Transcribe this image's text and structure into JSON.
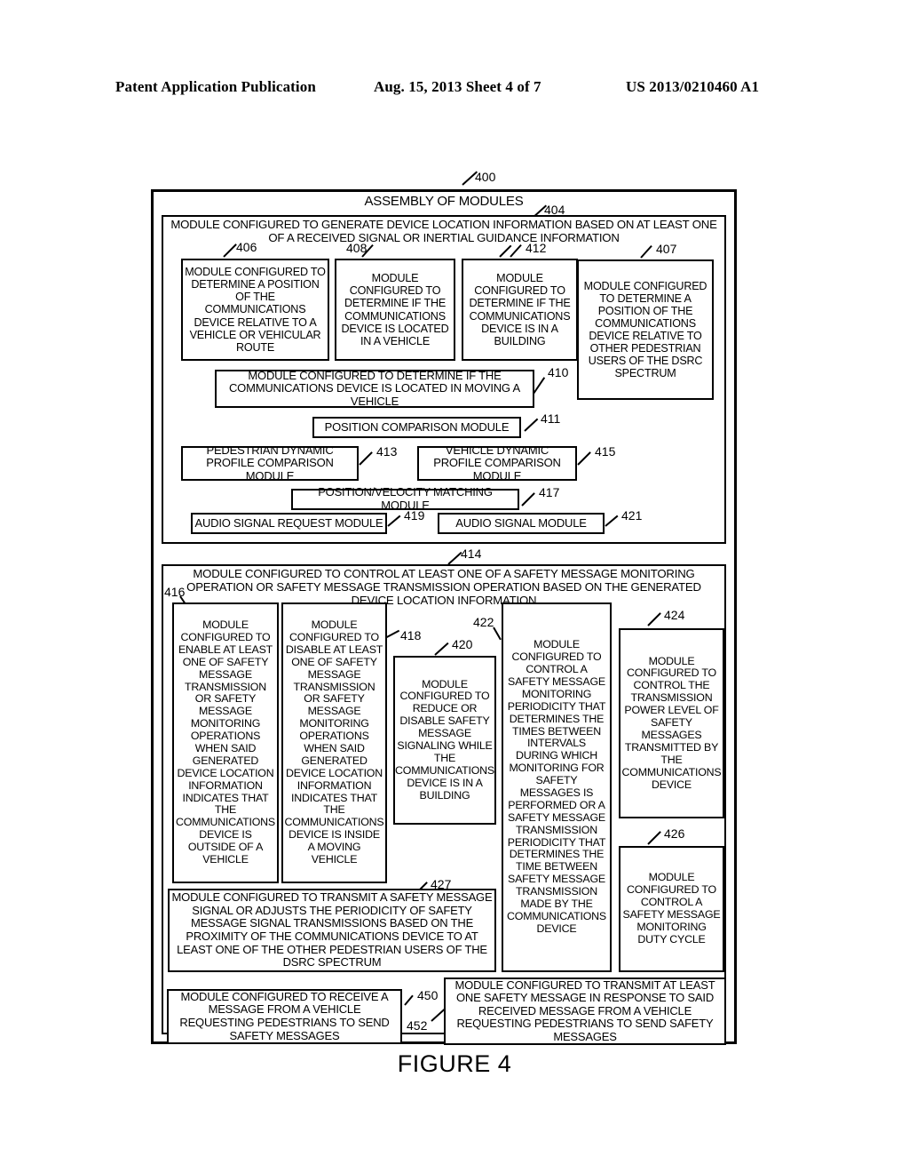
{
  "header": {
    "left": "Patent Application Publication",
    "middle": "Aug. 15, 2013  Sheet 4 of 7",
    "right": "US 2013/0210460 A1"
  },
  "figure": {
    "caption": "FIGURE 4",
    "assembly_label": "ASSEMBLY OF MODULES",
    "refs": {
      "r400": "400",
      "r404": "404",
      "r406": "406",
      "r407": "407",
      "r408": "408",
      "r410": "410",
      "r411": "411",
      "r412": "412",
      "r413": "413",
      "r414": "414",
      "r415": "415",
      "r416": "416",
      "r417": "417",
      "r418": "418",
      "r419": "419",
      "r420": "420",
      "r421": "421",
      "r422": "422",
      "r424": "424",
      "r426": "426",
      "r427": "427",
      "r450": "450",
      "r452": "452"
    },
    "blocks": {
      "b404": "MODULE CONFIGURED TO GENERATE DEVICE LOCATION INFORMATION BASED ON AT LEAST ONE OF A RECEIVED SIGNAL OR INERTIAL GUIDANCE INFORMATION",
      "b406": "MODULE CONFIGURED TO DETERMINE A POSITION OF THE COMMUNICATIONS DEVICE RELATIVE TO A VEHICLE OR VEHICULAR ROUTE",
      "b408": "MODULE CONFIGURED TO DETERMINE IF THE COMMUNICATIONS DEVICE IS LOCATED IN A VEHICLE",
      "b412": "MODULE CONFIGURED TO DETERMINE IF THE COMMUNICATIONS DEVICE IS IN A BUILDING",
      "b407": "MODULE CONFIGURED TO DETERMINE A POSITION OF THE COMMUNICATIONS DEVICE RELATIVE TO OTHER PEDESTRIAN USERS OF THE DSRC SPECTRUM",
      "b410": "MODULE CONFIGURED TO DETERMINE IF THE COMMUNICATIONS DEVICE IS LOCATED IN MOVING A VEHICLE",
      "b411": "POSITION COMPARISON MODULE",
      "b413": "PEDESTRIAN DYNAMIC PROFILE COMPARISON MODULE",
      "b415": "VEHICLE DYNAMIC PROFILE COMPARISON MODULE",
      "b417": "POSITION/VELOCITY MATCHING  MODULE",
      "b419": "AUDIO SIGNAL REQUEST MODULE",
      "b421": "AUDIO SIGNAL MODULE",
      "b414": "MODULE CONFIGURED TO CONTROL AT LEAST ONE OF A SAFETY MESSAGE MONITORING OPERATION OR SAFETY MESSAGE TRANSMISSION OPERATION BASED ON THE GENERATED DEVICE LOCATION INFORMATION",
      "b416": "MODULE CONFIGURED TO ENABLE AT LEAST ONE OF SAFETY MESSAGE TRANSMISSION OR SAFETY MESSAGE MONITORING OPERATIONS WHEN SAID GENERATED DEVICE LOCATION INFORMATION INDICATES THAT THE COMMUNICATIONS DEVICE IS OUTSIDE OF A VEHICLE",
      "b418": "MODULE CONFIGURED TO DISABLE AT LEAST ONE OF SAFETY MESSAGE TRANSMISSION OR SAFETY MESSAGE MONITORING OPERATIONS WHEN SAID GENERATED DEVICE LOCATION INFORMATION INDICATES THAT THE COMMUNICATIONS DEVICE IS INSIDE A MOVING VEHICLE",
      "b420": "MODULE CONFIGURED TO REDUCE OR DISABLE SAFETY MESSAGE SIGNALING WHILE THE COMMUNICATIONS DEVICE IS IN A BUILDING",
      "b422": "MODULE CONFIGURED TO CONTROL A SAFETY MESSAGE MONITORING PERIODICITY THAT DETERMINES THE TIMES BETWEEN INTERVALS DURING WHICH MONITORING FOR SAFETY MESSAGES IS PERFORMED OR A SAFETY MESSAGE TRANSMISSION PERIODICITY THAT DETERMINES THE TIME BETWEEN SAFETY MESSAGE TRANSMISSION MADE BY THE COMMUNICATIONS DEVICE",
      "b424": "MODULE CONFIGURED TO CONTROL THE TRANSMISSION POWER LEVEL OF SAFETY MESSAGES TRANSMITTED BY THE COMMUNICATIONS DEVICE",
      "b426": "MODULE CONFIGURED TO CONTROL A SAFETY MESSAGE MONITORING DUTY CYCLE",
      "b427": "MODULE CONFIGURED TO TRANSMIT A SAFETY MESSAGE SIGNAL OR ADJUSTS THE PERIODICITY OF SAFETY MESSAGE SIGNAL TRANSMISSIONS BASED ON THE PROXIMITY OF THE COMMUNICATIONS DEVICE TO AT LEAST ONE OF THE OTHER PEDESTRIAN USERS OF THE DSRC SPECTRUM",
      "b450": "MODULE CONFIGURED TO RECEIVE A MESSAGE FROM A VEHICLE REQUESTING PEDESTRIANS TO SEND SAFETY MESSAGES",
      "b452": "MODULE CONFIGURED TO TRANSMIT AT LEAST ONE SAFETY MESSAGE IN RESPONSE TO SAID RECEIVED MESSAGE FROM A VEHICLE REQUESTING PEDESTRIANS TO SEND SAFETY MESSAGES"
    }
  }
}
